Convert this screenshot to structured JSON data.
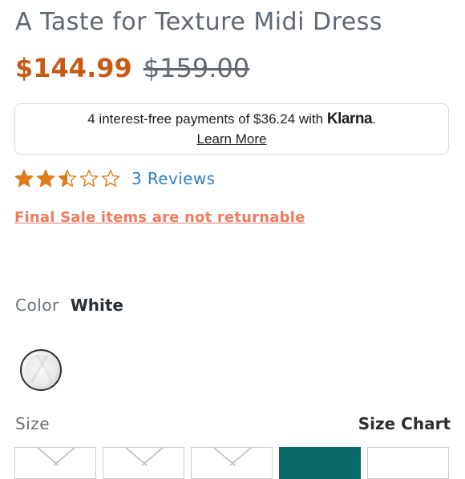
{
  "product": {
    "title": "A Taste for Texture Midi Dress",
    "sale_price": "$144.99",
    "original_price": "$159.00"
  },
  "klarna": {
    "message": "4 interest-free payments of $36.24 with",
    "brand": "Klarna",
    "period": ".",
    "learn_more": "Learn More"
  },
  "rating": {
    "value": 2.5,
    "max": 5,
    "reviews_label": "3 Reviews",
    "star_color": "#e07b1a"
  },
  "notice": {
    "final_sale": "Final Sale items are not returnable"
  },
  "color": {
    "label": "Color",
    "selected": "White"
  },
  "size": {
    "label": "Size",
    "chart_link": "Size Chart"
  },
  "colors": {
    "sale_price": "#c85a16",
    "final_sale": "#ee7b62",
    "reviews_link": "#2e7fc0",
    "selected_size": "#0b6b68"
  }
}
